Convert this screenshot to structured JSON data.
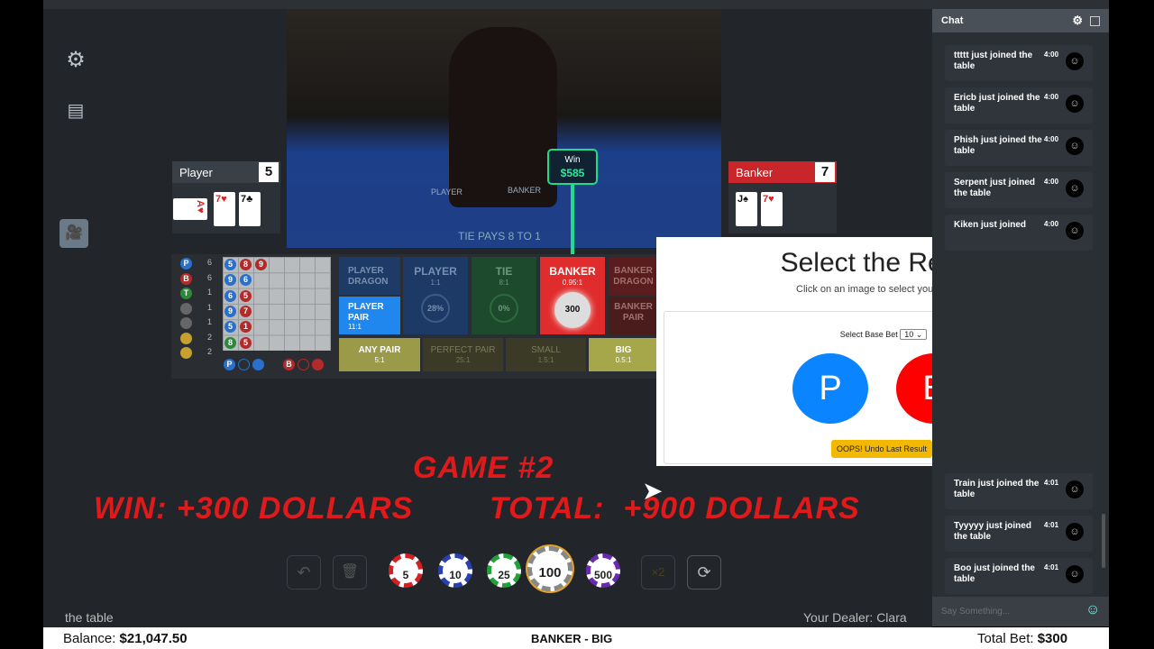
{
  "sidebar": {
    "icons": [
      "gear-icon",
      "notes-icon",
      "camera-icon"
    ]
  },
  "video": {
    "win_label": "Win",
    "win_amount": "$585",
    "table_text": "TIE PAYS 8 TO 1",
    "felt_player": "PLAYER",
    "felt_banker": "BANKER"
  },
  "player": {
    "label": "Player",
    "score": "5",
    "cards": [
      "A♥",
      "7♥",
      "7♣"
    ]
  },
  "banker": {
    "label": "Banker",
    "score": "7",
    "cards": [
      "J♠",
      "7♥"
    ]
  },
  "roadmap": {
    "stats": [
      {
        "k": "P",
        "v": "6"
      },
      {
        "k": "B",
        "v": "6"
      },
      {
        "k": "T",
        "v": "1"
      },
      {
        "k": "",
        "v": "1"
      },
      {
        "k": "",
        "v": "1"
      },
      {
        "k": "",
        "v": "2"
      },
      {
        "k": "",
        "v": "2"
      }
    ],
    "beads": [
      [
        "5",
        "8",
        "9"
      ],
      [
        "9",
        "6"
      ],
      [
        "6",
        "5"
      ],
      [
        "9",
        "7"
      ],
      [
        "5",
        "1"
      ],
      [
        "8",
        "5"
      ]
    ],
    "bead_colors": [
      [
        "#2a6fc9",
        "#b32a2a",
        "#b32a2a"
      ],
      [
        "#2a6fc9",
        "#2a6fc9"
      ],
      [
        "#2a6fc9",
        "#b32a2a"
      ],
      [
        "#2a6fc9",
        "#b32a2a"
      ],
      [
        "#2a6fc9",
        "#b32a2a"
      ],
      [
        "#2a8a3a",
        "#b32a2a"
      ]
    ],
    "predict_p": "P",
    "predict_b": "B"
  },
  "bets": {
    "player_dragon": "PLAYER DRAGON",
    "player": "PLAYER",
    "player_odds": "1:1",
    "player_pct": "28%",
    "tie": "TIE",
    "tie_odds": "8:1",
    "tie_pct": "0%",
    "banker": "BANKER",
    "banker_odds": "0.95:1",
    "banker_chip": "300",
    "banker_dragon": "BANKER DRAGON",
    "banker_pair": "BANKER PAIR",
    "player_pair": "PLAYER PAIR",
    "player_pair_odds": "11:1",
    "any_pair": "ANY PAIR",
    "any_pair_odds": "5:1",
    "perfect_pair": "PERFECT PAIR",
    "perfect_pair_odds": "25:1",
    "small": "SMALL",
    "small_odds": "1.5:1",
    "big": "BIG",
    "big_odds": "0.5:1"
  },
  "modal": {
    "title": "Select the Result",
    "subtitle": "Click on an image to select your option.",
    "base_bet_label": "Select Base Bet",
    "base_bet_value": "10",
    "p": "P",
    "b": "B",
    "undo": "OOPS! Undo Last Result",
    "p_color": "#0a84ff",
    "b_color": "#ff0000",
    "undo_color": "#f5b800"
  },
  "overlay": {
    "game": "GAME #2",
    "win": "WIN: +300 DOLLARS",
    "total": "TOTAL:  +900 DOLLARS"
  },
  "chips": [
    "5",
    "10",
    "25",
    "100",
    "500"
  ],
  "chip_colors": [
    "#d42020",
    "#2a3fb0",
    "#22a03a",
    "#888",
    "#6a2ab0"
  ],
  "footer": {
    "left": "the table",
    "dealer": "Your Dealer: Clara"
  },
  "chat": {
    "title": "Chat",
    "placeholder": "Say Something...",
    "messages": [
      {
        "text": "ttttt just joined the table",
        "time": "4:00"
      },
      {
        "text": "Ericb just joined the table",
        "time": "4:00"
      },
      {
        "text": "Phish just joined the table",
        "time": "4:00"
      },
      {
        "text": "Serpent just joined the table",
        "time": "4:00"
      },
      {
        "text": "Kiken just joined",
        "time": "4:00"
      }
    ],
    "messages_bottom": [
      {
        "text": "Train just joined the table",
        "time": "4:01"
      },
      {
        "text": "Tyyyyy just joined the table",
        "time": "4:01"
      },
      {
        "text": "Boo just joined the table",
        "time": "4:01"
      }
    ]
  },
  "status": {
    "balance_label": "Balance:",
    "balance": "$21,047.50",
    "result": "BANKER - BIG",
    "total_bet_label": "Total Bet:",
    "total_bet": "$300"
  }
}
